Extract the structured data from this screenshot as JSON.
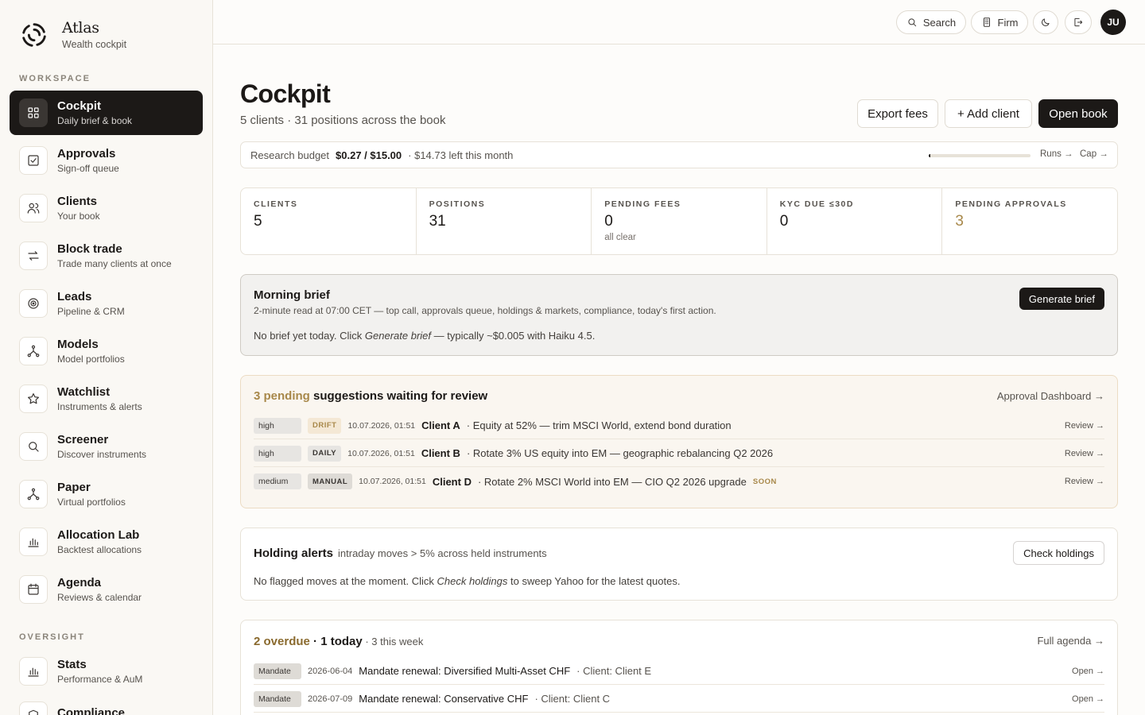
{
  "brand": {
    "name": "Atlas",
    "tagline": "Wealth cockpit"
  },
  "sidebar": {
    "workspace_label": "WORKSPACE",
    "oversight_label": "OVERSIGHT",
    "items": [
      {
        "title": "Cockpit",
        "sub": "Daily brief & book",
        "icon": "grid-icon"
      },
      {
        "title": "Approvals",
        "sub": "Sign-off queue",
        "icon": "checkbox-icon"
      },
      {
        "title": "Clients",
        "sub": "Your book",
        "icon": "users-icon"
      },
      {
        "title": "Block trade",
        "sub": "Trade many clients at once",
        "icon": "swap-arrows-icon"
      },
      {
        "title": "Leads",
        "sub": "Pipeline & CRM",
        "icon": "target-icon"
      },
      {
        "title": "Models",
        "sub": "Model portfolios",
        "icon": "network-icon"
      },
      {
        "title": "Watchlist",
        "sub": "Instruments & alerts",
        "icon": "star-icon"
      },
      {
        "title": "Screener",
        "sub": "Discover instruments",
        "icon": "search-icon"
      },
      {
        "title": "Paper",
        "sub": "Virtual portfolios",
        "icon": "network-icon"
      },
      {
        "title": "Allocation Lab",
        "sub": "Backtest allocations",
        "icon": "bar-chart-icon"
      },
      {
        "title": "Agenda",
        "sub": "Reviews & calendar",
        "icon": "calendar-icon"
      }
    ],
    "oversight_items": [
      {
        "title": "Stats",
        "sub": "Performance & AuM",
        "icon": "bar-chart-icon"
      },
      {
        "title": "Compliance",
        "sub": "",
        "icon": "shield-icon"
      }
    ]
  },
  "topbar": {
    "search": "Search",
    "firm": "Firm",
    "avatar": "JU"
  },
  "header": {
    "title": "Cockpit",
    "subtitle": "5 clients · 31 positions across the book",
    "export_fees": "Export fees",
    "add_client": "+ Add client",
    "open_book": "Open book"
  },
  "budget": {
    "label": "Research budget",
    "amount": "$0.27 / $15.00",
    "left": "· $14.73 left this month",
    "used_fraction": 0.018,
    "runs": "Runs →",
    "cap": "Cap →"
  },
  "stats": [
    {
      "label": "CLIENTS",
      "value": "5",
      "note": ""
    },
    {
      "label": "POSITIONS",
      "value": "31",
      "note": ""
    },
    {
      "label": "PENDING FEES",
      "value": "0",
      "note": "all clear"
    },
    {
      "label": "KYC DUE ≤30D",
      "value": "0",
      "note": ""
    },
    {
      "label": "PENDING APPROVALS",
      "value": "3",
      "note": ""
    }
  ],
  "brief": {
    "title": "Morning brief",
    "subtitle": "2-minute read at 07:00 CET — top call, approvals queue, holdings & markets, compliance, today's first action.",
    "note_before": "No brief yet today. Click ",
    "note_em": "Generate brief",
    "note_after": " — typically ~$0.005 with Haiku 4.5.",
    "button": "Generate brief"
  },
  "pending": {
    "count": "3 pending",
    "heading": " suggestions waiting for review",
    "link": "Approval Dashboard →",
    "rows": [
      {
        "priority": "high",
        "tag": "DRIFT",
        "date": "10.07.2026, 01:51",
        "client": "Client A",
        "desc": "· Equity at 52% — trim MSCI World, extend bond duration",
        "soon": "",
        "review": "Review →"
      },
      {
        "priority": "high",
        "tag": "DAILY",
        "date": "10.07.2026, 01:51",
        "client": "Client B",
        "desc": "· Rotate 3% US equity into EM — geographic rebalancing Q2 2026",
        "soon": "",
        "review": "Review →"
      },
      {
        "priority": "medium",
        "tag": "MANUAL",
        "date": "10.07.2026, 01:51",
        "client": "Client D",
        "desc": "· Rotate 2% MSCI World into EM — CIO Q2 2026 upgrade",
        "soon": "SOON",
        "review": "Review →"
      }
    ]
  },
  "alerts": {
    "title": "Holding alerts",
    "subtitle": "intraday moves > 5% across held instruments",
    "button": "Check holdings",
    "note_before": "No flagged moves at the moment. Click ",
    "note_em": "Check holdings",
    "note_after": " to sweep Yahoo for the latest quotes."
  },
  "agenda": {
    "overdue": "2 overdue",
    "today": " · 1 today",
    "week": " · 3 this week",
    "link": "Full agenda →",
    "rows": [
      {
        "tag": "Mandate",
        "date": "2026-06-04",
        "title": "Mandate renewal: Diversified Multi-Asset CHF",
        "client": "· Client: Client E",
        "open": "Open →"
      },
      {
        "tag": "Mandate",
        "date": "2026-07-09",
        "title": "Mandate renewal: Conservative CHF",
        "client": "· Client: Client C",
        "open": "Open →"
      }
    ]
  }
}
